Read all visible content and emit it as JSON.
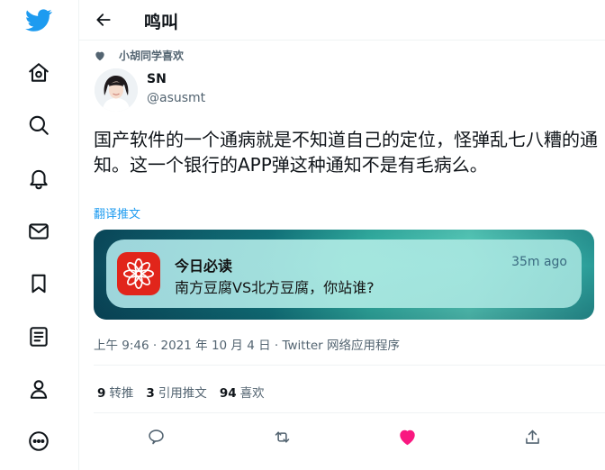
{
  "nav": {
    "items": [
      {
        "icon": "twitter-logo-icon"
      },
      {
        "icon": "home-icon"
      },
      {
        "icon": "explore-search-icon"
      },
      {
        "icon": "notifications-bell-icon"
      },
      {
        "icon": "messages-mail-icon"
      },
      {
        "icon": "bookmarks-icon"
      },
      {
        "icon": "lists-icon"
      },
      {
        "icon": "profile-icon"
      },
      {
        "icon": "more-icon"
      }
    ]
  },
  "header": {
    "title": "鸣叫"
  },
  "social_context": {
    "text": "小胡同学喜欢"
  },
  "author": {
    "name": "SN",
    "handle": "@asusmt"
  },
  "tweet": {
    "text": "国产软件的一个通病就是不知道自己的定位，怪弹乱七八糟的通知。这一个银行的APP弹这种通知不是有毛病么。",
    "translate_label": "翻译推文"
  },
  "media": {
    "notification": {
      "app_name": "今日必读",
      "time": "35m ago",
      "body": "南方豆腐VS北方豆腐，你站谁?"
    }
  },
  "meta": {
    "time": "上午 9:46",
    "separator1": "·",
    "date": "2021 年 10 月 4 日",
    "separator2": "·",
    "source": "Twitter 网络应用程序"
  },
  "stats": {
    "retweets_count": "9",
    "retweets_label": "转推",
    "quotes_count": "3",
    "quotes_label": "引用推文",
    "likes_count": "94",
    "likes_label": "喜欢"
  },
  "colors": {
    "accent": "#1d9bf0",
    "like": "#f91880",
    "muted": "#536471"
  }
}
